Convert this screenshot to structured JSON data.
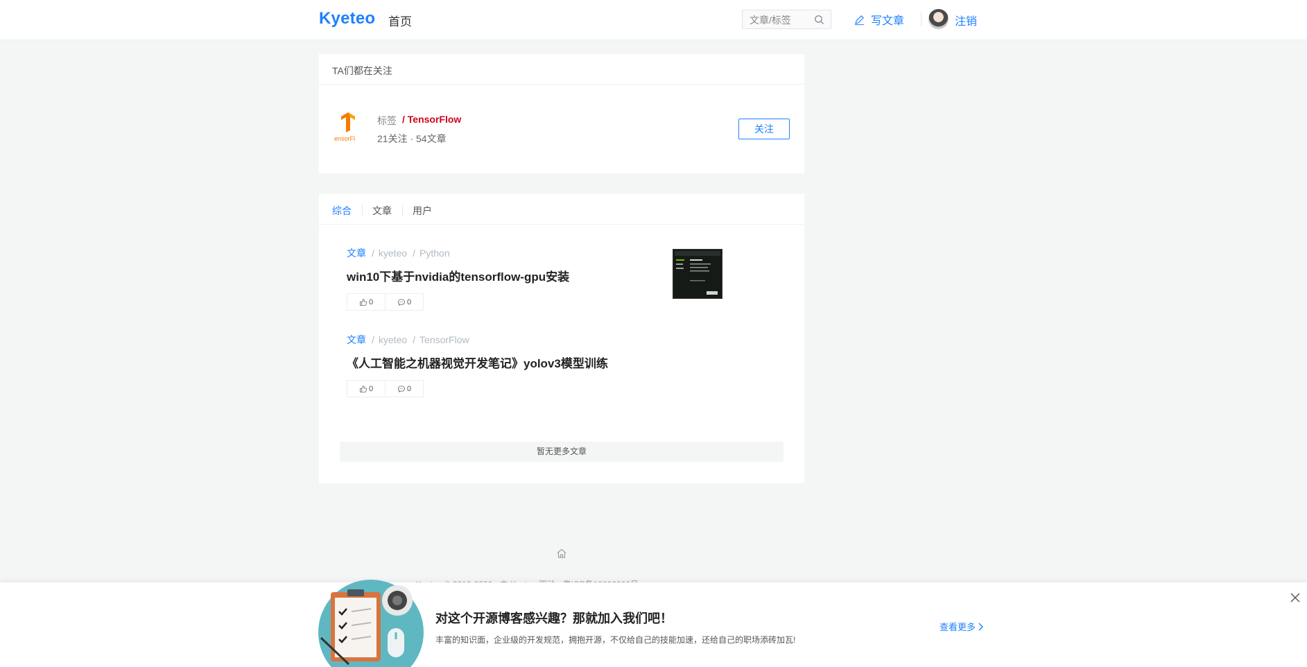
{
  "header": {
    "logo": "Kyeteo",
    "home_label": "首页",
    "search_placeholder": "文章/标签",
    "write_label": "写文章",
    "logout_label": "注销"
  },
  "tag_card": {
    "title": "TA们都在关注",
    "tag_label": "标签",
    "tag_name": "/ TensorFlow",
    "stats": "21关注 · 54文章",
    "follow_label": "关注"
  },
  "feed": {
    "tabs": [
      {
        "label": "综合",
        "active": true
      },
      {
        "label": "文章",
        "active": false
      },
      {
        "label": "用户",
        "active": false
      }
    ],
    "articles": [
      {
        "category": "文章",
        "author": "kyeteo",
        "tag": "Python",
        "title": "win10下基于nvidia的tensorflow-gpu安装",
        "likes": "0",
        "comments": "0",
        "has_thumbnail": true
      },
      {
        "category": "文章",
        "author": "kyeteo",
        "tag": "TensorFlow",
        "title": "《人工智能之机器视觉开发笔记》yolov3模型训练",
        "likes": "0",
        "comments": "0",
        "has_thumbnail": false
      }
    ],
    "no_more_label": "暂无更多文章"
  },
  "footer": {
    "copyright": "Kyeteo © 2019-2020 · 由 Kyeteo 驱动 · 粤ICP备18006000号"
  },
  "banner": {
    "title": "对这个开源博客感兴趣？那就加入我们吧！",
    "description": "丰富的知识面，企业级的开发规范，拥抱开源，不仅给自己的技能加速，还给自己的职场添砖加瓦!",
    "more_label": "查看更多"
  },
  "colors": {
    "accent": "#1e80ff",
    "tag_red": "#d0021b",
    "page_bg": "#f4f5f5"
  }
}
